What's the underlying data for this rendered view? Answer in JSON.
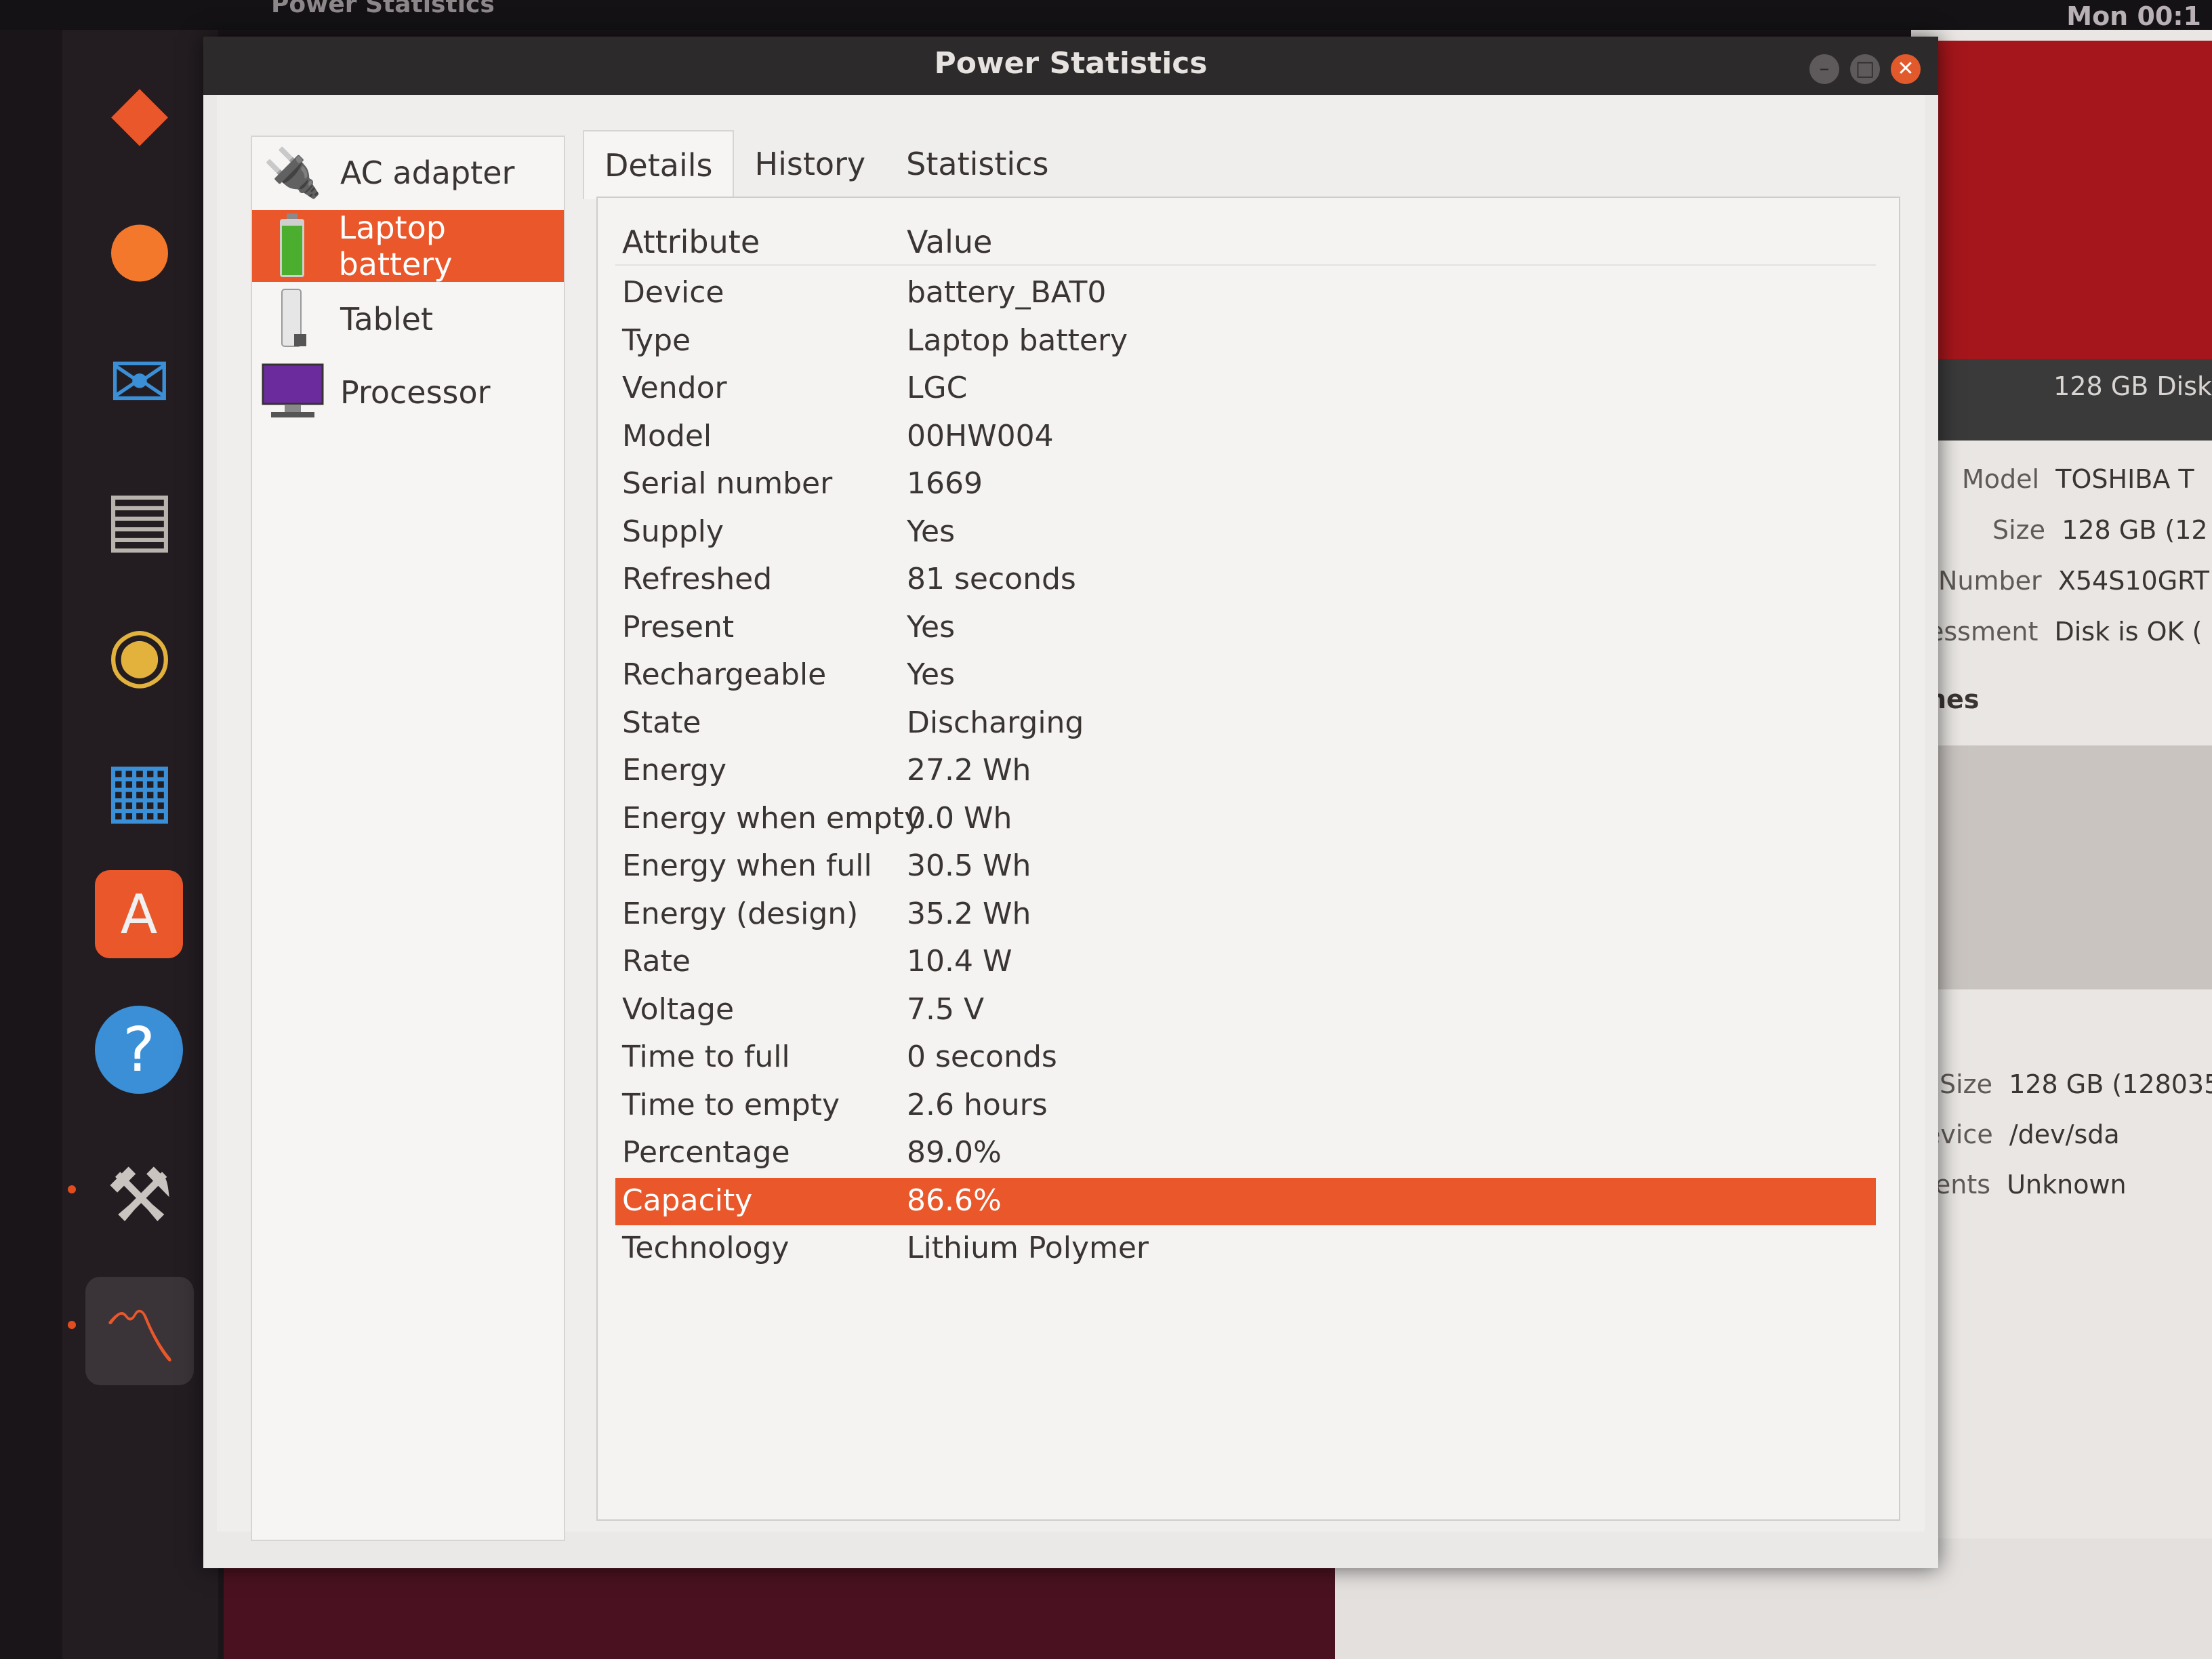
{
  "topbar": {
    "app_label": "Power Statistics",
    "clock": "Mon 00:1"
  },
  "dock": {
    "items": [
      {
        "name": "dock-ubuntu-installer-icon",
        "glyph": "◆"
      },
      {
        "name": "dock-firefox-icon",
        "glyph": "●"
      },
      {
        "name": "dock-thunderbird-icon",
        "glyph": "✉"
      },
      {
        "name": "dock-files-icon",
        "glyph": "▤"
      },
      {
        "name": "dock-rhythmbox-icon",
        "glyph": "◉"
      },
      {
        "name": "dock-writer-icon",
        "glyph": "▦"
      },
      {
        "name": "dock-software-icon",
        "glyph": "A"
      },
      {
        "name": "dock-help-icon",
        "glyph": "?"
      },
      {
        "name": "dock-disks-icon",
        "glyph": "⚒"
      },
      {
        "name": "dock-power-statistics-icon",
        "glyph": "〽"
      }
    ]
  },
  "window": {
    "title": "Power Statistics"
  },
  "sidebar": {
    "items": [
      {
        "label": "AC adapter",
        "icon": "ac-adapter-icon"
      },
      {
        "label": "Laptop battery",
        "icon": "battery-icon"
      },
      {
        "label": "Tablet",
        "icon": "tablet-icon"
      },
      {
        "label": "Processor",
        "icon": "processor-icon"
      }
    ]
  },
  "tabs": [
    {
      "label": "Details"
    },
    {
      "label": "History"
    },
    {
      "label": "Statistics"
    }
  ],
  "details": {
    "headers": {
      "attribute": "Attribute",
      "value": "Value"
    },
    "rows": [
      {
        "attr": "Device",
        "value": "battery_BAT0"
      },
      {
        "attr": "Type",
        "value": "Laptop battery"
      },
      {
        "attr": "Vendor",
        "value": "LGC"
      },
      {
        "attr": "Model",
        "value": "00HW004"
      },
      {
        "attr": "Serial number",
        "value": "1669"
      },
      {
        "attr": "Supply",
        "value": "Yes"
      },
      {
        "attr": "Refreshed",
        "value": "81 seconds"
      },
      {
        "attr": "Present",
        "value": "Yes"
      },
      {
        "attr": "Rechargeable",
        "value": "Yes"
      },
      {
        "attr": "State",
        "value": "Discharging"
      },
      {
        "attr": "Energy",
        "value": "27.2 Wh"
      },
      {
        "attr": "Energy when empty",
        "value": "0.0 Wh"
      },
      {
        "attr": "Energy when full",
        "value": "30.5 Wh"
      },
      {
        "attr": "Energy (design)",
        "value": "35.2 Wh"
      },
      {
        "attr": "Rate",
        "value": "10.4 W"
      },
      {
        "attr": "Voltage",
        "value": "7.5 V"
      },
      {
        "attr": "Time to full",
        "value": "0 seconds"
      },
      {
        "attr": "Time to empty",
        "value": "2.6 hours"
      },
      {
        "attr": "Percentage",
        "value": "89.0%"
      },
      {
        "attr": "Capacity",
        "value": "86.6%"
      },
      {
        "attr": "Technology",
        "value": "Lithium Polymer"
      }
    ]
  },
  "background_disks": {
    "banner": "128 GB Disk",
    "rows": [
      {
        "label": "Model",
        "value": "TOSHIBA T"
      },
      {
        "label": "Size",
        "value": "128 GB (12"
      },
      {
        "label": "Number",
        "value": "X54S10GRT"
      },
      {
        "label": "essment",
        "value": "Disk is OK ("
      },
      {
        "label": "nes",
        "value": ""
      },
      {
        "label": "Size",
        "value": "128 GB (128035"
      },
      {
        "label": "evice",
        "value": "/dev/sda"
      },
      {
        "label": "tents",
        "value": "Unknown"
      }
    ]
  },
  "colors": {
    "accent": "#e9572a",
    "titlebar": "#2d2a2c",
    "dock": "#231d22"
  }
}
